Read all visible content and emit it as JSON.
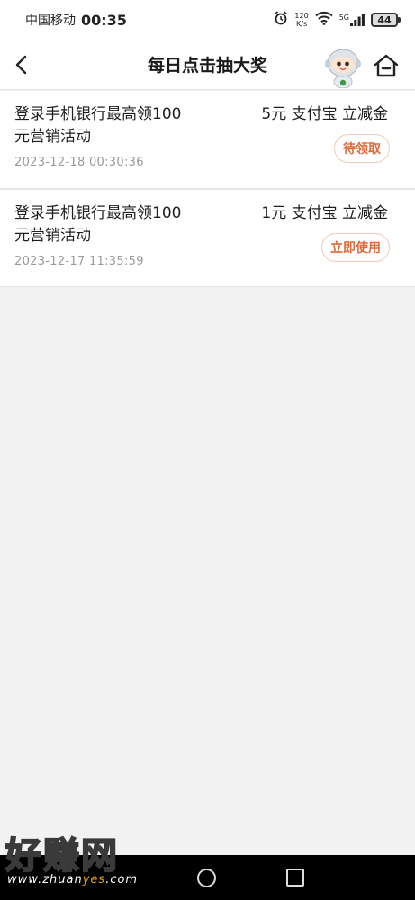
{
  "status_bar": {
    "carrier": "中国移动",
    "time": "00:35",
    "speed_value": "120",
    "speed_unit": "K/s",
    "network": "5G",
    "battery": "44"
  },
  "header": {
    "title": "每日点击抽大奖"
  },
  "records": [
    {
      "title": "登录手机银行最高领100元营销活动",
      "date": "2023-12-18 00:30:36",
      "prize": "5元 支付宝 立减金",
      "action": "待领取"
    },
    {
      "title": "登录手机银行最高领100元营销活动",
      "date": "2023-12-17 11:35:59",
      "prize": "1元 支付宝 立减金",
      "action": "立即使用"
    }
  ],
  "watermark": {
    "text": "好赚网",
    "url_pre": "www.zhuan",
    "url_hl": "yes",
    "url_post": ".com"
  },
  "colors": {
    "accent": "#e0693a",
    "background": "#f2f2f2"
  }
}
